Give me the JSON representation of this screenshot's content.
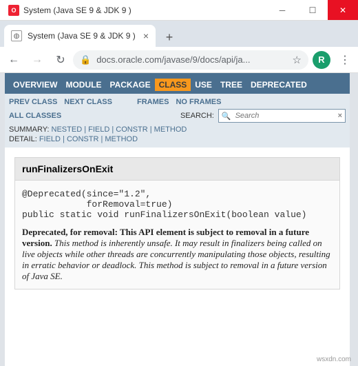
{
  "window": {
    "title": "System (Java SE 9 & JDK 9 )"
  },
  "browser": {
    "tab_title": "System (Java SE 9 & JDK 9 )",
    "url_display": "docs.oracle.com/javase/9/docs/api/ja...",
    "avatar_letter": "R"
  },
  "nav": {
    "items": [
      "OVERVIEW",
      "MODULE",
      "PACKAGE",
      "CLASS",
      "USE",
      "TREE",
      "DEPRECATED"
    ],
    "active_index": 3,
    "prev": "PREV CLASS",
    "next": "NEXT CLASS",
    "frames": "FRAMES",
    "noframes": "NO FRAMES",
    "allclasses": "ALL CLASSES",
    "search_label": "SEARCH:",
    "search_placeholder": "Search",
    "summary_prefix": "SUMMARY: ",
    "summary_links": "NESTED | FIELD | CONSTR | METHOD",
    "detail_prefix": "DETAIL: ",
    "detail_links": "FIELD | CONSTR | METHOD"
  },
  "method": {
    "name": "runFinalizersOnExit",
    "anno_line1": "@Deprecated(since=\"1.2\",",
    "anno_line2": "            forRemoval=true)",
    "sig": "public static void runFinalizersOnExit(boolean value)",
    "dep_strong": "Deprecated, for removal: This API element is subject to removal in a future version.",
    "dep_body": " This method is inherently unsafe. It may result in finalizers being called on live objects while other threads are concurrently manipulating those objects, resulting in erratic behavior or deadlock. This method is subject to removal in a future version of Java SE."
  },
  "watermark": "wsxdn.com"
}
